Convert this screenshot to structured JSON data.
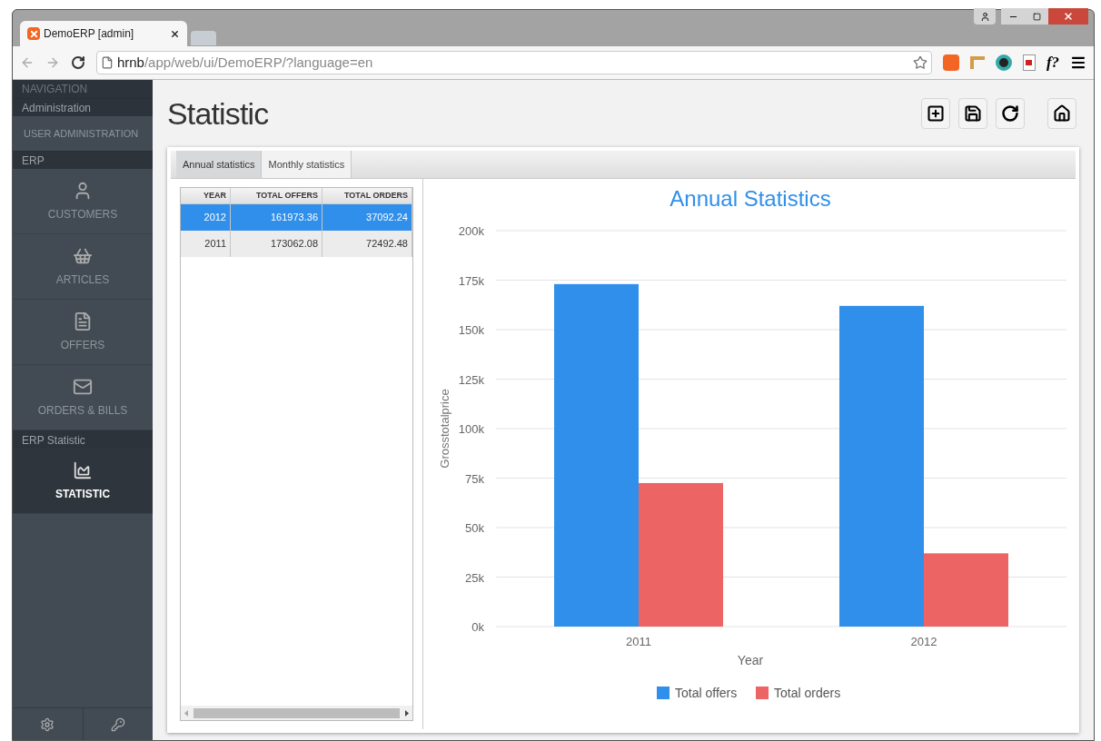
{
  "browser": {
    "tab_title": "DemoERP [admin]",
    "url_host": "hrnb",
    "url_path": "/app/web/ui/DemoERP/?language=en",
    "extension_text": "f?"
  },
  "sidebar": {
    "title": "NAVIGATION",
    "sections": [
      {
        "title": "Administration",
        "items": [
          {
            "label": "USER ADMINISTRATION",
            "selected": false,
            "kind": "text"
          }
        ]
      },
      {
        "title": "ERP",
        "items": [
          {
            "label": "CUSTOMERS",
            "selected": false,
            "kind": "icon"
          },
          {
            "label": "ARTICLES",
            "selected": false,
            "kind": "icon"
          },
          {
            "label": "OFFERS",
            "selected": false,
            "kind": "icon"
          },
          {
            "label": "ORDERS & BILLS",
            "selected": false,
            "kind": "icon"
          }
        ]
      },
      {
        "title": "ERP Statistic",
        "items": [
          {
            "label": "STATISTIC",
            "selected": true,
            "kind": "icon"
          }
        ]
      }
    ]
  },
  "page": {
    "title": "Statistic"
  },
  "tabs": [
    {
      "label": "Annual statistics",
      "selected": true
    },
    {
      "label": "Monthly statistics",
      "selected": false
    }
  ],
  "table": {
    "columns": [
      "YEAR",
      "TOTAL OFFERS",
      "TOTAL ORDERS"
    ],
    "rows": [
      {
        "cells": [
          "2012",
          "161973.36",
          "37092.24"
        ],
        "selected": true
      },
      {
        "cells": [
          "2011",
          "173062.08",
          "72492.48"
        ],
        "selected": false
      }
    ]
  },
  "chart": {
    "chart_data": {
      "type": "bar",
      "title": "Annual Statistics",
      "xlabel": "Year",
      "ylabel": "Grosstotalprice",
      "categories": [
        "2011",
        "2012"
      ],
      "series": [
        {
          "name": "Total offers",
          "color": "#2f8fea",
          "values": [
            173000,
            162000
          ]
        },
        {
          "name": "Total orders",
          "color": "#ec6464",
          "values": [
            72500,
            37000
          ]
        }
      ],
      "grid": true,
      "legend": "bottom",
      "ylim": [
        0,
        200000
      ],
      "yticks": [
        {
          "value": 0,
          "label": "0k"
        },
        {
          "value": 25000,
          "label": "25k"
        },
        {
          "value": 50000,
          "label": "50k"
        },
        {
          "value": 75000,
          "label": "75k"
        },
        {
          "value": 100000,
          "label": "100k"
        },
        {
          "value": 125000,
          "label": "125k"
        },
        {
          "value": 150000,
          "label": "150k"
        },
        {
          "value": 175000,
          "label": "175k"
        },
        {
          "value": 200000,
          "label": "200k"
        }
      ]
    }
  }
}
